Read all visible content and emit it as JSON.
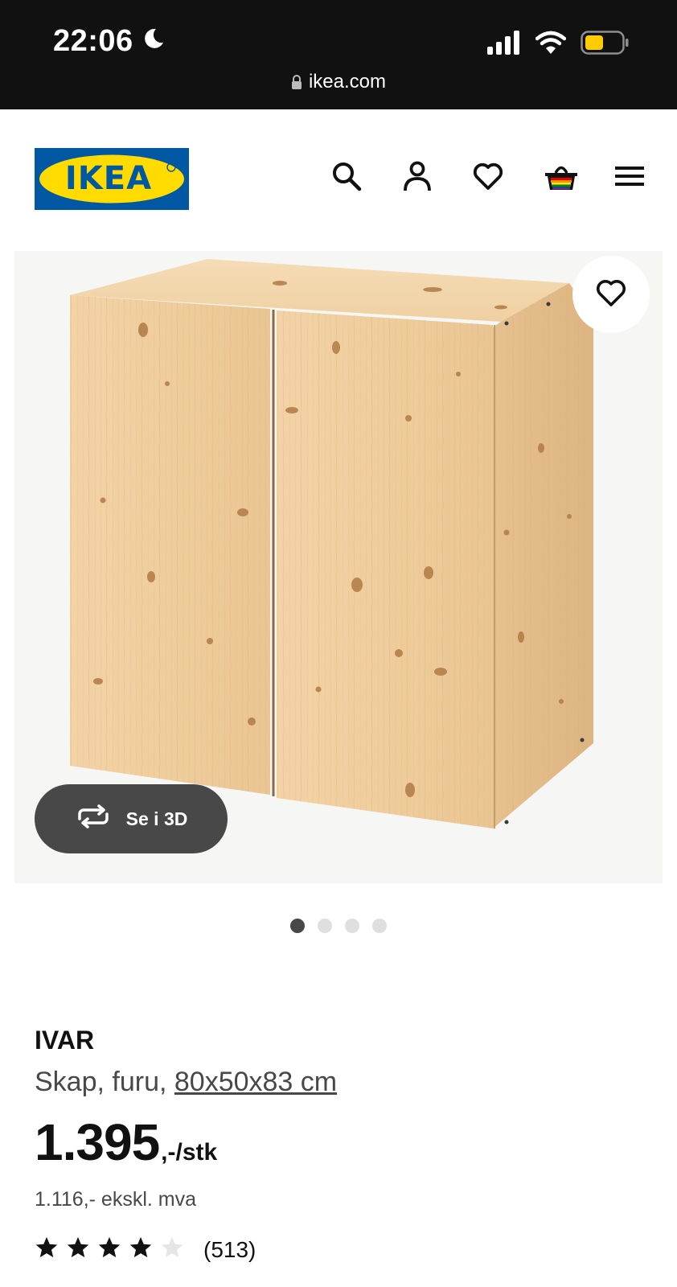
{
  "status_bar": {
    "time": "22:06",
    "url": "ikea.com",
    "battery_color": "#ffcc00"
  },
  "header": {
    "logo_text": "IKEA",
    "icons": [
      "search-icon",
      "user-icon",
      "heart-icon",
      "basket-icon",
      "menu-icon"
    ]
  },
  "gallery": {
    "view_3d_label": "Se i 3D",
    "page_count": 4,
    "active_page": 1
  },
  "product": {
    "name": "IVAR",
    "description_prefix": "Skap, furu, ",
    "dimensions": "80x50x83 cm",
    "price_integer": "1.395",
    "price_suffix": ",-/stk",
    "price_ex_vat": "1.116,- ekskl. mva",
    "rating": 4,
    "rating_max": 5,
    "review_count": "(513)"
  },
  "colors": {
    "brand_blue": "#0058a3",
    "brand_yellow": "#ffdb00",
    "text_dark": "#111111",
    "text_muted": "#484848"
  }
}
